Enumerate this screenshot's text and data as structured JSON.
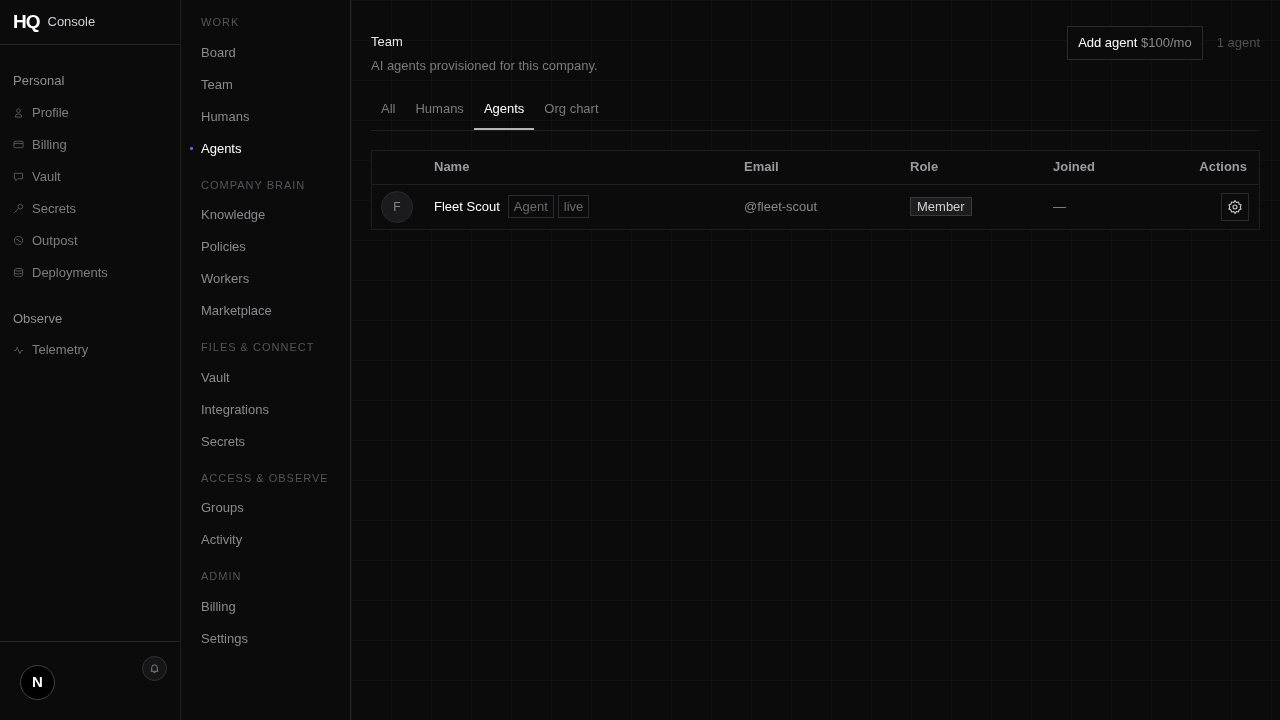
{
  "brand": {
    "logo": "HQ",
    "title": "Console"
  },
  "personal": {
    "title": "Personal",
    "items": [
      {
        "label": "Profile",
        "selected": false
      },
      {
        "label": "Billing",
        "selected": false
      },
      {
        "label": "Vault",
        "selected": false
      },
      {
        "label": "Secrets",
        "selected": false
      },
      {
        "label": "Outpost",
        "selected": false
      },
      {
        "label": "Deployments",
        "selected": false
      }
    ]
  },
  "observe": {
    "title": "Observe",
    "items": [
      {
        "label": "Telemetry",
        "selected": false
      }
    ]
  },
  "user": {
    "initial": "N"
  },
  "nav_sections": [
    {
      "title": "WORK",
      "items": [
        {
          "label": "Board",
          "selected": false
        },
        {
          "label": "Team",
          "selected": false
        },
        {
          "label": "Humans",
          "selected": false
        },
        {
          "label": "Agents",
          "selected": true
        }
      ]
    },
    {
      "title": "COMPANY BRAIN",
      "items": [
        {
          "label": "Knowledge",
          "selected": false
        },
        {
          "label": "Policies",
          "selected": false
        },
        {
          "label": "Workers",
          "selected": false
        },
        {
          "label": "Marketplace",
          "selected": false
        }
      ]
    },
    {
      "title": "FILES & CONNECT",
      "items": [
        {
          "label": "Vault",
          "selected": false
        },
        {
          "label": "Integrations",
          "selected": false
        },
        {
          "label": "Secrets",
          "selected": false
        }
      ]
    },
    {
      "title": "ACCESS & OBSERVE",
      "items": [
        {
          "label": "Groups",
          "selected": false
        },
        {
          "label": "Activity",
          "selected": false
        }
      ]
    },
    {
      "title": "ADMIN",
      "items": [
        {
          "label": "Billing",
          "selected": false
        },
        {
          "label": "Settings",
          "selected": false
        }
      ]
    }
  ],
  "page": {
    "title": "Team",
    "subtitle": "AI agents provisioned for this company.",
    "add_button": {
      "label": "Add agent",
      "price": "$100/mo"
    },
    "count": "1 agent"
  },
  "tabs": [
    {
      "label": "All",
      "selected": false
    },
    {
      "label": "Humans",
      "selected": false
    },
    {
      "label": "Agents",
      "selected": true
    },
    {
      "label": "Org chart",
      "selected": false
    }
  ],
  "table": {
    "columns": [
      "Name",
      "Email",
      "Role",
      "Joined",
      "Actions"
    ],
    "rows": [
      {
        "initial": "F",
        "name": "Fleet Scout",
        "tags": [
          "Agent",
          "live"
        ],
        "email": "@fleet-scout",
        "role": "Member",
        "joined": "—"
      }
    ]
  }
}
